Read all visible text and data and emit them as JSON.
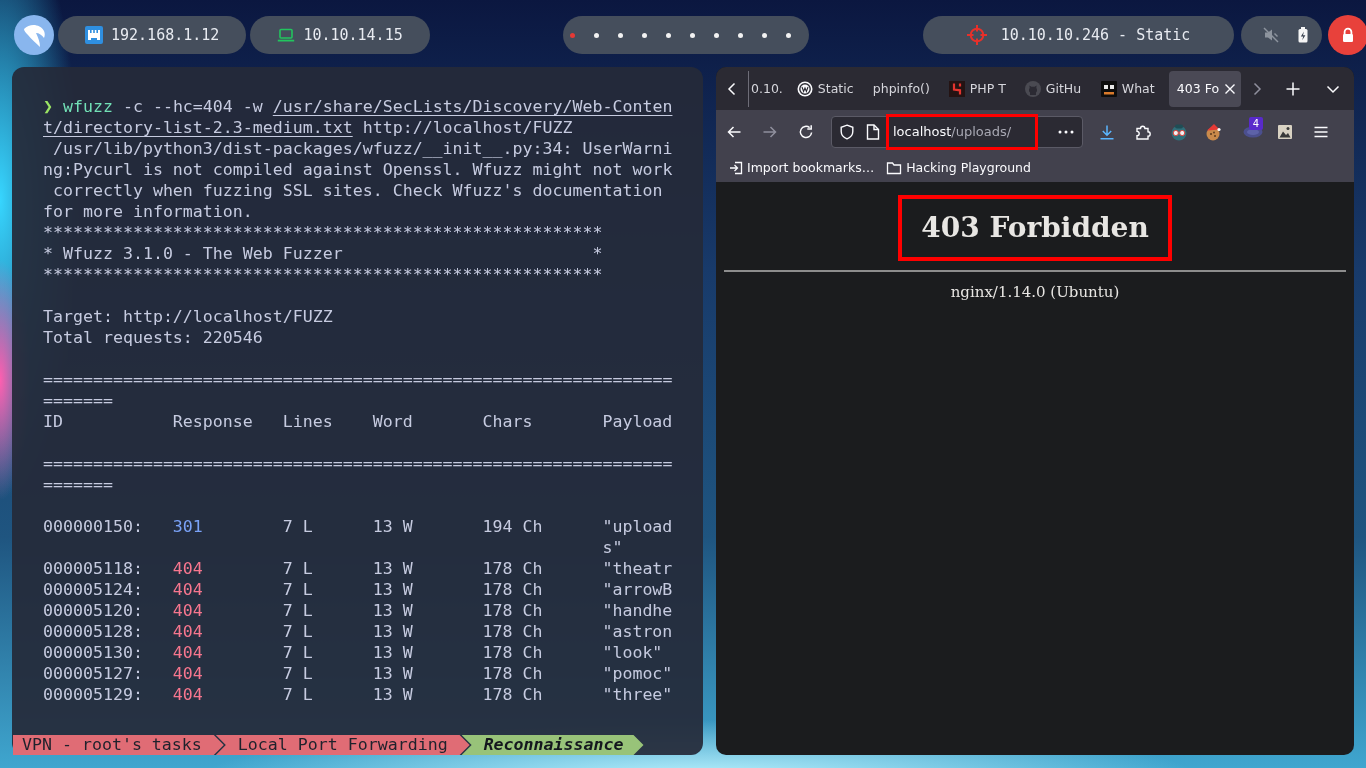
{
  "top_bar": {
    "interfaces": [
      {
        "kind": "ethernet",
        "address": "192.168.1.12"
      },
      {
        "kind": "laptop",
        "address": "10.10.14.15"
      }
    ],
    "workspaces": [
      {
        "selected": true
      },
      {
        "selected": false
      },
      {
        "selected": false
      },
      {
        "selected": false
      },
      {
        "selected": false
      },
      {
        "selected": false
      },
      {
        "selected": false
      },
      {
        "selected": false
      },
      {
        "selected": false
      },
      {
        "selected": false
      }
    ],
    "target": "10.10.10.246 - Static",
    "system": {
      "muted": true,
      "charging": true
    }
  },
  "terminal": {
    "command": {
      "prompt": "❯",
      "program": "wfuzz",
      "options": "-c --hc=404 -w",
      "wordlist": "/usr/share/SecLists/Discovery/Web-Content/directory-list-2.3-medium.txt",
      "url": "http://localhost/FUZZ"
    },
    "warning": "/usr/lib/python3/dist-packages/wfuzz/__init__.py:34: UserWarning:Pycurl is not compiled against Openssl. Wfuzz might not work correctly when fuzzing SSL sites. Check Wfuzz's documentation for more information.",
    "banner": [
      "********************************************************",
      "* Wfuzz 3.1.0 - The Web Fuzzer                         *",
      "********************************************************"
    ],
    "target_line": "Target: http://localhost/FUZZ",
    "total_line": "Total requests: 220546",
    "rule_above": "======================================================================",
    "columns": [
      "ID",
      "Response",
      "Lines",
      "Word",
      "Chars",
      "Payload"
    ],
    "rule_below": "======================================================================",
    "rows": [
      {
        "id": "000000150:",
        "response": "301",
        "color": "#7aa2f7",
        "lines": "7 L",
        "words": "13 W",
        "chars": "194 Ch",
        "payload": "\"uploads\""
      },
      {
        "id": "000005118:",
        "response": "404",
        "color": "#f7768e",
        "lines": "7 L",
        "words": "13 W",
        "chars": "178 Ch",
        "payload": "\"theatr"
      },
      {
        "id": "000005124:",
        "response": "404",
        "color": "#f7768e",
        "lines": "7 L",
        "words": "13 W",
        "chars": "178 Ch",
        "payload": "\"arrowB"
      },
      {
        "id": "000005120:",
        "response": "404",
        "color": "#f7768e",
        "lines": "7 L",
        "words": "13 W",
        "chars": "178 Ch",
        "payload": "\"handhe"
      },
      {
        "id": "000005128:",
        "response": "404",
        "color": "#f7768e",
        "lines": "7 L",
        "words": "13 W",
        "chars": "178 Ch",
        "payload": "\"astron"
      },
      {
        "id": "000005130:",
        "response": "404",
        "color": "#f7768e",
        "lines": "7 L",
        "words": "13 W",
        "chars": "178 Ch",
        "payload": "\"look\""
      },
      {
        "id": "000005127:",
        "response": "404",
        "color": "#f7768e",
        "lines": "7 L",
        "words": "13 W",
        "chars": "178 Ch",
        "payload": "\"pomoc\""
      },
      {
        "id": "000005129:",
        "response": "404",
        "color": "#f7768e",
        "lines": "7 L",
        "words": "13 W",
        "chars": "178 Ch",
        "payload": "\"three\""
      }
    ],
    "breadcrumb": [
      {
        "label": "VPN - root's tasks",
        "selected": false
      },
      {
        "label": "Local Port Forwarding",
        "selected": false
      },
      {
        "label": "Reconnaissance",
        "selected": true
      }
    ]
  },
  "browser": {
    "tabs": [
      {
        "kind": "none",
        "title": "0.10.",
        "selected": false
      },
      {
        "kind": "circle-logo",
        "title": "Static",
        "selected": false
      },
      {
        "kind": "none",
        "title": "phpinfo()",
        "selected": false
      },
      {
        "kind": "bracket-logo",
        "title": "PHP T",
        "selected": false
      },
      {
        "kind": "cat-logo",
        "title": "GitHu",
        "selected": false
      },
      {
        "kind": "dark-logo",
        "title": "What",
        "selected": false
      },
      {
        "kind": "none",
        "title": "403 Fo",
        "selected": true
      }
    ],
    "navigation": {
      "back_enabled": true,
      "forward_enabled": false
    },
    "address": {
      "host": "localhost",
      "path": "/uploads/",
      "highlighted": true
    },
    "extension_badge": "4",
    "bookmarks": [
      {
        "kind": "import",
        "label": "Import bookmarks…"
      },
      {
        "kind": "folder",
        "label": "Hacking Playground"
      }
    ],
    "page": {
      "heading": "403 Forbidden",
      "heading_highlighted": true,
      "server": "nginx/1.14.0 (Ubuntu)"
    }
  }
}
